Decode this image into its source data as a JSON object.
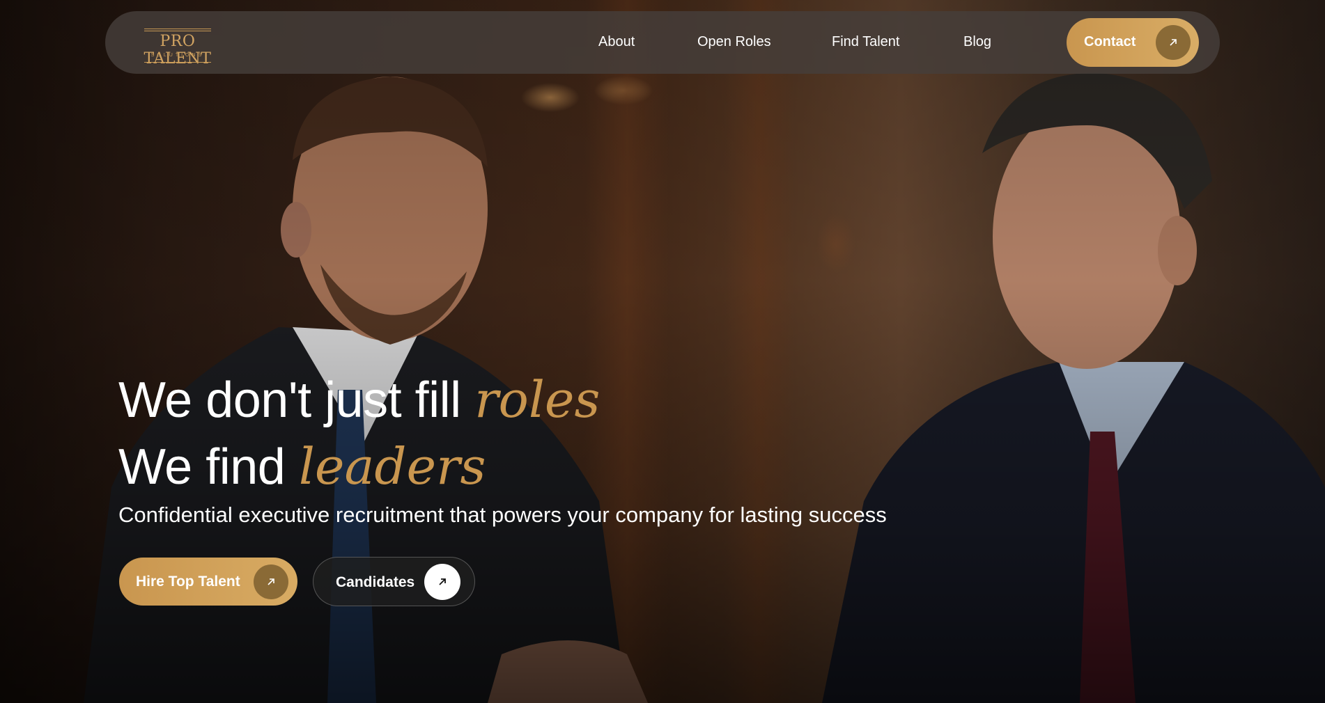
{
  "brand": {
    "name": "PRO TALENT",
    "tagline": "SOLUTIONS",
    "accent_color": "#c9964f"
  },
  "nav": {
    "links": [
      "About",
      "Open Roles",
      "Find Talent",
      "Blog"
    ],
    "contact_label": "Contact",
    "contact_icon": "arrow-up-right-icon"
  },
  "hero": {
    "line1_text": "We don't just fill",
    "line1_accent": "roles",
    "line2_text": "We find",
    "line2_accent": "leaders",
    "subtitle": "Confidential executive recruitment that powers your company for lasting success",
    "primary_button": "Hire Top Talent",
    "secondary_button": "Candidates",
    "button_icon": "arrow-up-right-icon"
  }
}
